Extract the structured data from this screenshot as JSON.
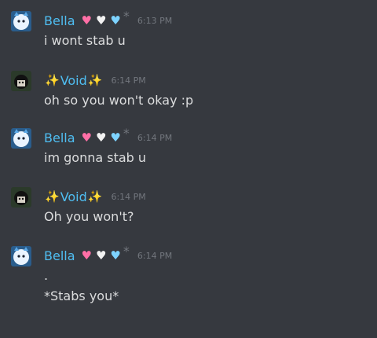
{
  "messages": [
    {
      "author": "Bella",
      "sparkles": false,
      "badges": [
        "pink-heart",
        "white-heart",
        "blue-heart"
      ],
      "star": "*",
      "time": "6:13 PM",
      "lines": [
        "i wont stab u"
      ]
    },
    {
      "author": "Void",
      "sparkles": true,
      "sparkle_glyph": "✨",
      "time": "6:14 PM",
      "lines": [
        "oh so you won't okay :p"
      ]
    },
    {
      "author": "Bella",
      "sparkles": false,
      "badges": [
        "pink-heart",
        "white-heart",
        "blue-heart"
      ],
      "star": "*",
      "time": "6:14 PM",
      "lines": [
        "im gonna stab u"
      ]
    },
    {
      "author": "Void",
      "sparkles": true,
      "sparkle_glyph": "✨",
      "time": "6:14 PM",
      "lines": [
        "Oh you won't?"
      ]
    },
    {
      "author": "Bella",
      "sparkles": false,
      "badges": [
        "pink-heart",
        "white-heart",
        "blue-heart"
      ],
      "star": "*",
      "time": "6:14 PM",
      "lines": [
        ".",
        "*Stabs you*"
      ]
    }
  ],
  "colors": {
    "background": "#36393f",
    "username": "#4fbef2",
    "text": "#dcddde",
    "timestamp": "#72767d",
    "pink_heart": "#ff6fa6",
    "white_heart": "#f2f2f2",
    "blue_heart": "#7dd3ff"
  },
  "icons": {
    "sparkle": "sparkles-emoji",
    "hearts": [
      "pink-heart-icon",
      "white-heart-icon",
      "blue-heart-icon"
    ],
    "cat_avatar": "blue-cat-avatar",
    "void_avatar": "dark-haired-avatar"
  }
}
